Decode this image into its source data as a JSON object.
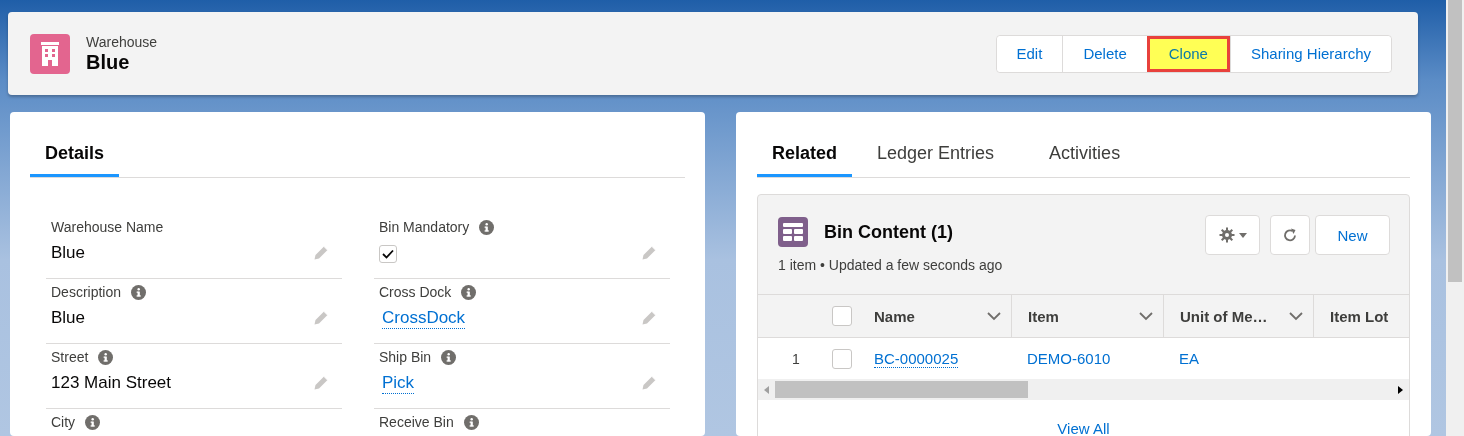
{
  "header": {
    "object_type": "Warehouse",
    "title": "Blue",
    "actions": [
      {
        "label": "Edit",
        "highlighted": false
      },
      {
        "label": "Delete",
        "highlighted": false
      },
      {
        "label": "Clone",
        "highlighted": true
      },
      {
        "label": "Sharing Hierarchy",
        "highlighted": false
      }
    ]
  },
  "details": {
    "tabs": [
      {
        "label": "Details",
        "selected": true
      }
    ],
    "fields": [
      {
        "label": "Warehouse Name",
        "info": false,
        "kind": "text",
        "value": "Blue"
      },
      {
        "label": "Bin Mandatory",
        "info": true,
        "kind": "checkbox",
        "checked": true
      },
      {
        "label": "Description",
        "info": true,
        "kind": "text",
        "value": "Blue"
      },
      {
        "label": "Cross Dock",
        "info": true,
        "kind": "link",
        "value": "CrossDock"
      },
      {
        "label": "Street",
        "info": true,
        "kind": "text",
        "value": "123 Main Street"
      },
      {
        "label": "Ship Bin",
        "info": true,
        "kind": "link",
        "value": "Pick"
      },
      {
        "label": "City",
        "info": true,
        "kind": "text"
      },
      {
        "label": "Receive Bin",
        "info": true,
        "kind": "link"
      }
    ]
  },
  "related": {
    "tabs": [
      {
        "label": "Related",
        "selected": true
      },
      {
        "label": "Ledger Entries",
        "selected": false
      },
      {
        "label": "Activities",
        "selected": false
      }
    ],
    "list": {
      "title": "Bin Content (1)",
      "subtitle": "1 item • Updated a few seconds ago",
      "actions": [
        {
          "kind": "settings"
        },
        {
          "kind": "refresh"
        },
        {
          "kind": "button",
          "label": "New"
        }
      ],
      "all_selected": false,
      "columns": [
        {
          "label": "Name",
          "menu": true
        },
        {
          "label": "Item",
          "menu": true
        },
        {
          "label": "Unit of Me…",
          "menu": true
        },
        {
          "label": "Item Lot",
          "menu": false
        }
      ],
      "rows": [
        {
          "number": "1",
          "selected": false,
          "cells": [
            "BC-0000025",
            "DEMO-6010",
            "EA"
          ]
        }
      ],
      "footer_link": "View All"
    }
  }
}
